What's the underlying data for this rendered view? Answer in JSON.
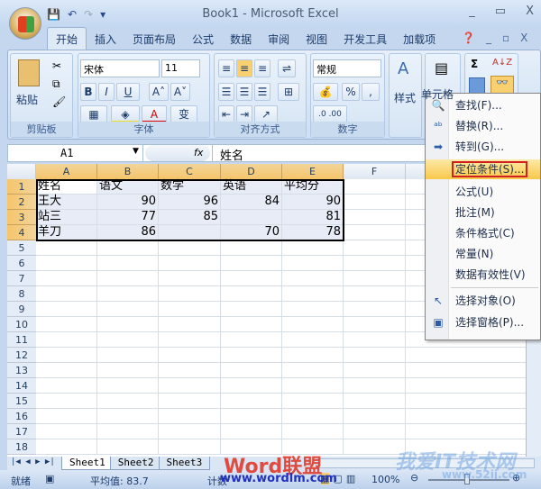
{
  "window": {
    "title": "Book1 - Microsoft Excel",
    "min": "_",
    "max": "▭",
    "close": "X"
  },
  "qat": {
    "save": "💾",
    "undo": "↶",
    "redo": "↷",
    "customize": "▾"
  },
  "tabs": [
    "开始",
    "插入",
    "页面布局",
    "公式",
    "数据",
    "审阅",
    "视图",
    "开发工具",
    "加载项"
  ],
  "ribbon": {
    "clipboard": {
      "label": "剪贴板",
      "paste": "粘贴"
    },
    "font": {
      "label": "字体",
      "name": "宋体",
      "size": "11",
      "bold": "B",
      "italic": "I",
      "underline": "U",
      "grow": "A˄",
      "shrink": "A˅"
    },
    "alignment": {
      "label": "对齐方式"
    },
    "number": {
      "label": "数字",
      "format": "常规",
      "percent": "%",
      "comma": ","
    },
    "styles": {
      "label": "样式"
    },
    "cells": {
      "label": "单元格"
    },
    "editing": {
      "sum": "Σ",
      "sort": "A↓Z",
      "find": "👓"
    }
  },
  "formula_bar": {
    "name_box": "A1",
    "fx": "fx",
    "value": "姓名"
  },
  "columns": [
    "A",
    "B",
    "C",
    "D",
    "E",
    "F"
  ],
  "rows": [
    "1",
    "2",
    "3",
    "4",
    "5",
    "6",
    "7",
    "8",
    "9",
    "10",
    "11",
    "12",
    "13",
    "14",
    "15",
    "16",
    "17",
    "18"
  ],
  "cells": [
    [
      "姓名",
      "语文",
      "数学",
      "英语",
      "平均分"
    ],
    [
      "王大",
      "90",
      "96",
      "84",
      "90"
    ],
    [
      "站三",
      "77",
      "85",
      "",
      "81"
    ],
    [
      "羊刀",
      "86",
      "",
      "70",
      "78"
    ]
  ],
  "menu": {
    "items": [
      {
        "label": "查找(F)...",
        "icon": "find-icon"
      },
      {
        "label": "替换(R)...",
        "icon": "replace-icon"
      },
      {
        "label": "转到(G)...",
        "icon": "goto-arrow-icon"
      },
      {
        "label": "定位条件(S)...",
        "icon": ""
      },
      {
        "label": "公式(U)",
        "icon": ""
      },
      {
        "label": "批注(M)",
        "icon": ""
      },
      {
        "label": "条件格式(C)",
        "icon": ""
      },
      {
        "label": "常量(N)",
        "icon": ""
      },
      {
        "label": "数据有效性(V)",
        "icon": ""
      },
      {
        "label": "选择对象(O)",
        "icon": "pointer-icon"
      },
      {
        "label": "选择窗格(P)...",
        "icon": "selection-pane-icon"
      }
    ],
    "highlight_color": "#d02020"
  },
  "sheets": [
    "Sheet1",
    "Sheet2",
    "Sheet3"
  ],
  "status": {
    "ready": "就绪",
    "average": "平均值: 83.7",
    "count": "计数",
    "zoom": "100%"
  },
  "watermarks": {
    "word": "Word联盟",
    "word_url": "www.wordlm.com",
    "site": "我爱IT技术网",
    "site_url": "www.52ij.com"
  }
}
